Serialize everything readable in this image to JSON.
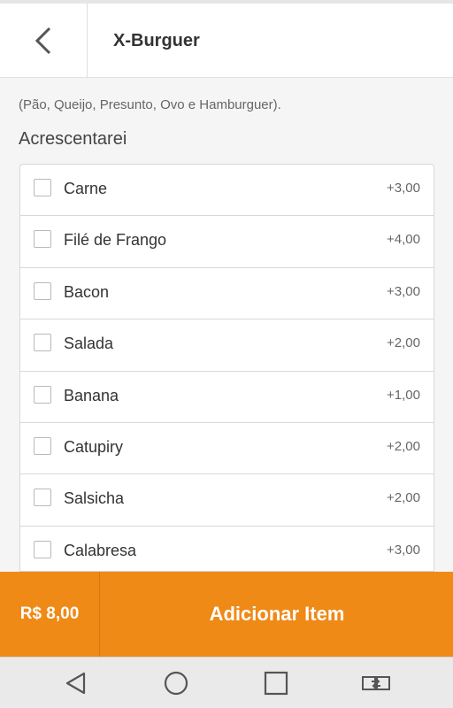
{
  "header": {
    "title": "X-Burguer",
    "back_icon": "chevron-left-icon"
  },
  "description": "(Pão, Queijo, Presunto, Ovo e Hamburguer).",
  "section": {
    "title": "Acrescentarei"
  },
  "options": [
    {
      "name": "Carne",
      "price": "+3,00"
    },
    {
      "name": "Filé de Frango",
      "price": "+4,00"
    },
    {
      "name": "Bacon",
      "price": "+3,00"
    },
    {
      "name": "Salada",
      "price": "+2,00"
    },
    {
      "name": "Banana",
      "price": "+1,00"
    },
    {
      "name": "Catupiry",
      "price": "+2,00"
    },
    {
      "name": "Salsicha",
      "price": "+2,00"
    },
    {
      "name": "Calabresa",
      "price": "+3,00"
    }
  ],
  "footer": {
    "total": "R$ 8,00",
    "add_label": "Adicionar Item"
  },
  "colors": {
    "accent": "#ef8a17",
    "navbar": "#eaeaea"
  },
  "navigation": {
    "icons": [
      "back-triangle-icon",
      "home-circle-icon",
      "recents-square-icon",
      "switch-apps-icon"
    ]
  }
}
